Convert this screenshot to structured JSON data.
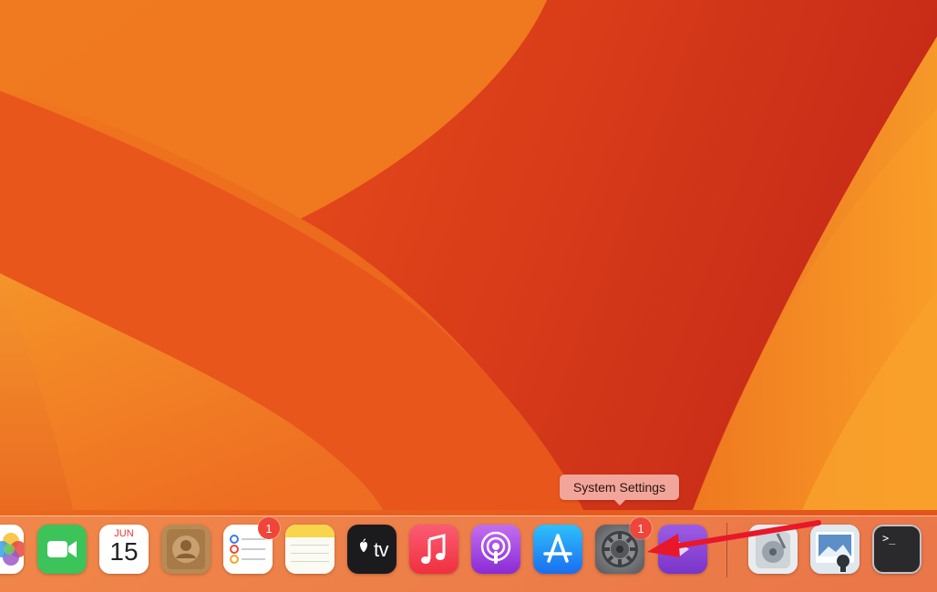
{
  "tooltip": {
    "text": "System Settings"
  },
  "dock": {
    "apps": [
      {
        "id": "photos",
        "icon": "photos-icon"
      },
      {
        "id": "facetime",
        "icon": "facetime-icon"
      },
      {
        "id": "calendar",
        "icon": "calendar-icon",
        "month": "JUN",
        "day": "15"
      },
      {
        "id": "contacts",
        "icon": "contacts-icon"
      },
      {
        "id": "reminders",
        "icon": "reminders-icon",
        "badge": "1"
      },
      {
        "id": "notes",
        "icon": "notes-icon"
      },
      {
        "id": "appletv",
        "icon": "apple-tv-icon",
        "label": "tv"
      },
      {
        "id": "music",
        "icon": "music-icon"
      },
      {
        "id": "podcasts",
        "icon": "podcasts-icon"
      },
      {
        "id": "appstore",
        "icon": "app-store-icon"
      },
      {
        "id": "settings",
        "icon": "gear-icon",
        "badge": "1"
      },
      {
        "id": "purple-app",
        "icon": "purple-app-icon"
      },
      {
        "id": "disk-utility",
        "icon": "disk-utility-icon"
      },
      {
        "id": "preview",
        "icon": "preview-icon"
      },
      {
        "id": "terminal",
        "icon": "terminal-icon",
        "prompt": ">_"
      }
    ]
  },
  "colors": {
    "wallpaper_base": "#e2521c",
    "badge": "#f0453a",
    "tooltip_bg": "#f2a59a",
    "annotation_arrow": "#e8182a"
  }
}
